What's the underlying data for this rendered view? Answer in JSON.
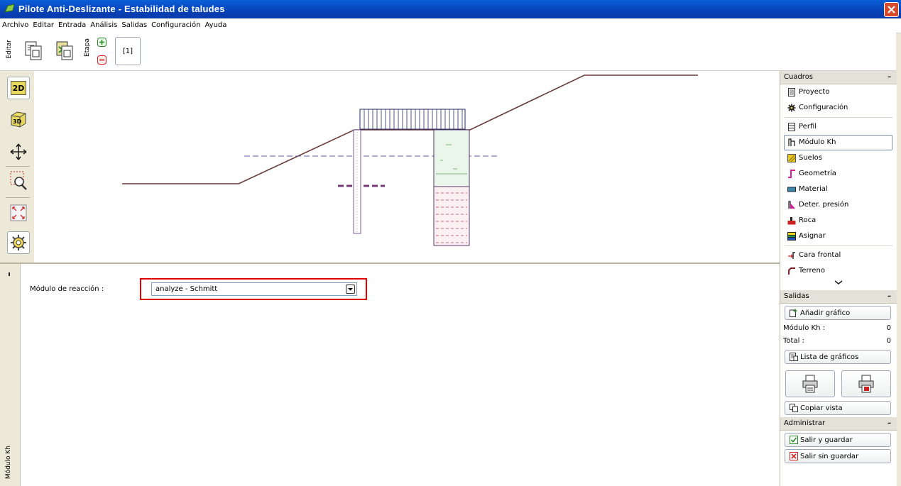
{
  "window": {
    "title": "Pilote Anti-Deslizante - Estabilidad de taludes"
  },
  "menu": [
    "Archivo",
    "Editar",
    "Entrada",
    "Análisis",
    "Salidas",
    "Configuración",
    "Ayuda"
  ],
  "toolbar": {
    "edit_label": "Editar",
    "stage_label": "Etapa",
    "stage_tab": "[1]"
  },
  "left_tools": [
    "2D",
    "3D"
  ],
  "form": {
    "field_label": "Módulo de reacción :",
    "selected_value": "analyze - Schmitt",
    "highlight_color": "#e00000"
  },
  "bottom_vertical_label": "Módulo Kh",
  "cuadros": {
    "header": "Cuadros",
    "items": [
      {
        "label": "Proyecto",
        "icon": "document-icon"
      },
      {
        "label": "Configuración",
        "icon": "gear-icon"
      },
      {
        "label": "Perfil",
        "icon": "profile-icon"
      },
      {
        "label": "Módulo Kh",
        "icon": "kh-modulus-icon"
      },
      {
        "label": "Suelos",
        "icon": "soil-icon"
      },
      {
        "label": "Geometría",
        "icon": "geometry-icon"
      },
      {
        "label": "Material",
        "icon": "material-icon"
      },
      {
        "label": "Deter. presión",
        "icon": "pressure-icon"
      },
      {
        "label": "Roca",
        "icon": "rock-icon"
      },
      {
        "label": "Asignar",
        "icon": "assign-icon"
      },
      {
        "label": "Cara frontal",
        "icon": "front-face-icon"
      },
      {
        "label": "Terreno",
        "icon": "terrain-icon"
      }
    ]
  },
  "salidas": {
    "header": "Salidas",
    "add_graph": "Añadir gráfico",
    "rows": [
      {
        "label": "Módulo Kh :",
        "value": "0"
      },
      {
        "label": "Total :",
        "value": "0"
      }
    ],
    "graph_list": "Lista de gráficos",
    "copy_view": "Copiar vista"
  },
  "administrar": {
    "header": "Administrar",
    "save_exit": "Salir y guardar",
    "exit_no_save": "Salir sin guardar"
  }
}
